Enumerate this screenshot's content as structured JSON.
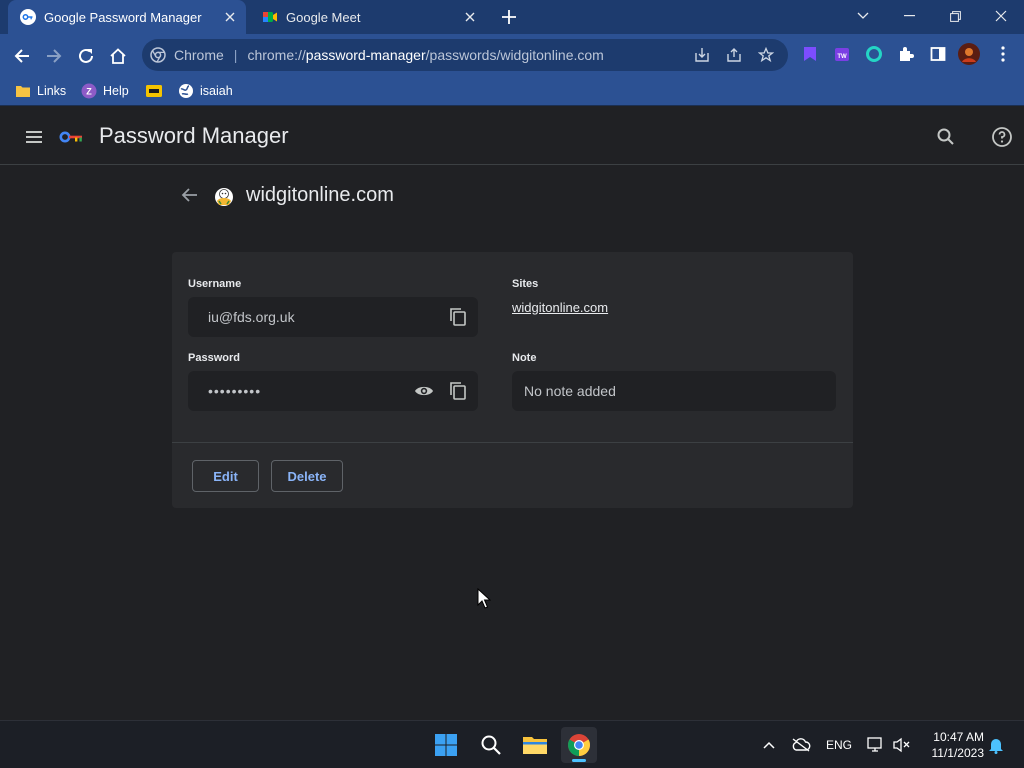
{
  "browser": {
    "tabs": [
      {
        "title": "Google Password Manager",
        "active": true
      },
      {
        "title": "Google Meet",
        "active": false
      }
    ],
    "omnibox": {
      "chip_label": "Chrome",
      "url_scheme": "chrome://",
      "url_host": "password-manager",
      "url_path": "/passwords/widgitonline.com"
    },
    "bookmarks": [
      {
        "label": "Links",
        "icon": "folder-icon"
      },
      {
        "label": "Help",
        "icon": "help-z-icon"
      },
      {
        "label": "",
        "icon": "yellow-bookmark-icon"
      },
      {
        "label": "isaiah",
        "icon": "globe-icon"
      }
    ]
  },
  "app": {
    "title": "Password Manager"
  },
  "detail": {
    "site": "widgitonline.com",
    "username_label": "Username",
    "username_value": "iu@fds.org.uk",
    "password_label": "Password",
    "password_value": "•••••••••",
    "sites_label": "Sites",
    "site_link": "widgitonline.com",
    "note_label": "Note",
    "note_value": "No note added",
    "edit_label": "Edit",
    "delete_label": "Delete"
  },
  "taskbar": {
    "language": "ENG",
    "time": "10:47 AM",
    "date": "11/1/2023"
  },
  "colors": {
    "tabstrip": "#1d3b6e",
    "toolbar": "#2c5193",
    "page_bg": "#202124",
    "card_bg": "#292a2d",
    "accent": "#8ab4f8"
  }
}
